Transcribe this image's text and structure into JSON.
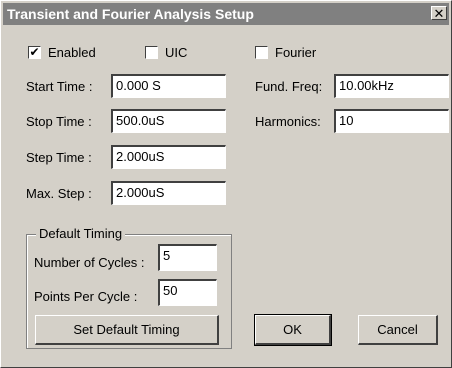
{
  "window": {
    "title": "Transient and Fourier Analysis Setup",
    "close_glyph": "✕"
  },
  "options": {
    "enabled": {
      "label": "Enabled",
      "checked": true
    },
    "uic": {
      "label": "UIC",
      "checked": false
    },
    "fourier": {
      "label": "Fourier",
      "checked": false
    },
    "check_glyph": "✔"
  },
  "fields": {
    "start_time": {
      "label": "Start Time :",
      "value": "0.000 S"
    },
    "stop_time": {
      "label": "Stop Time :",
      "value": "500.0uS"
    },
    "step_time": {
      "label": "Step Time :",
      "value": "2.000uS"
    },
    "max_step": {
      "label": "Max. Step :",
      "value": "2.000uS"
    },
    "fund_freq": {
      "label": "Fund. Freq:",
      "value": "10.00kHz"
    },
    "harmonics": {
      "label": "Harmonics:",
      "value": "10"
    }
  },
  "default_timing": {
    "title": "Default Timing",
    "cycles_label": "Number of Cycles :",
    "cycles_value": "5",
    "points_label": "Points Per Cycle :",
    "points_value": "50",
    "set_button": "Set Default Timing"
  },
  "buttons": {
    "ok": "OK",
    "cancel": "Cancel"
  }
}
